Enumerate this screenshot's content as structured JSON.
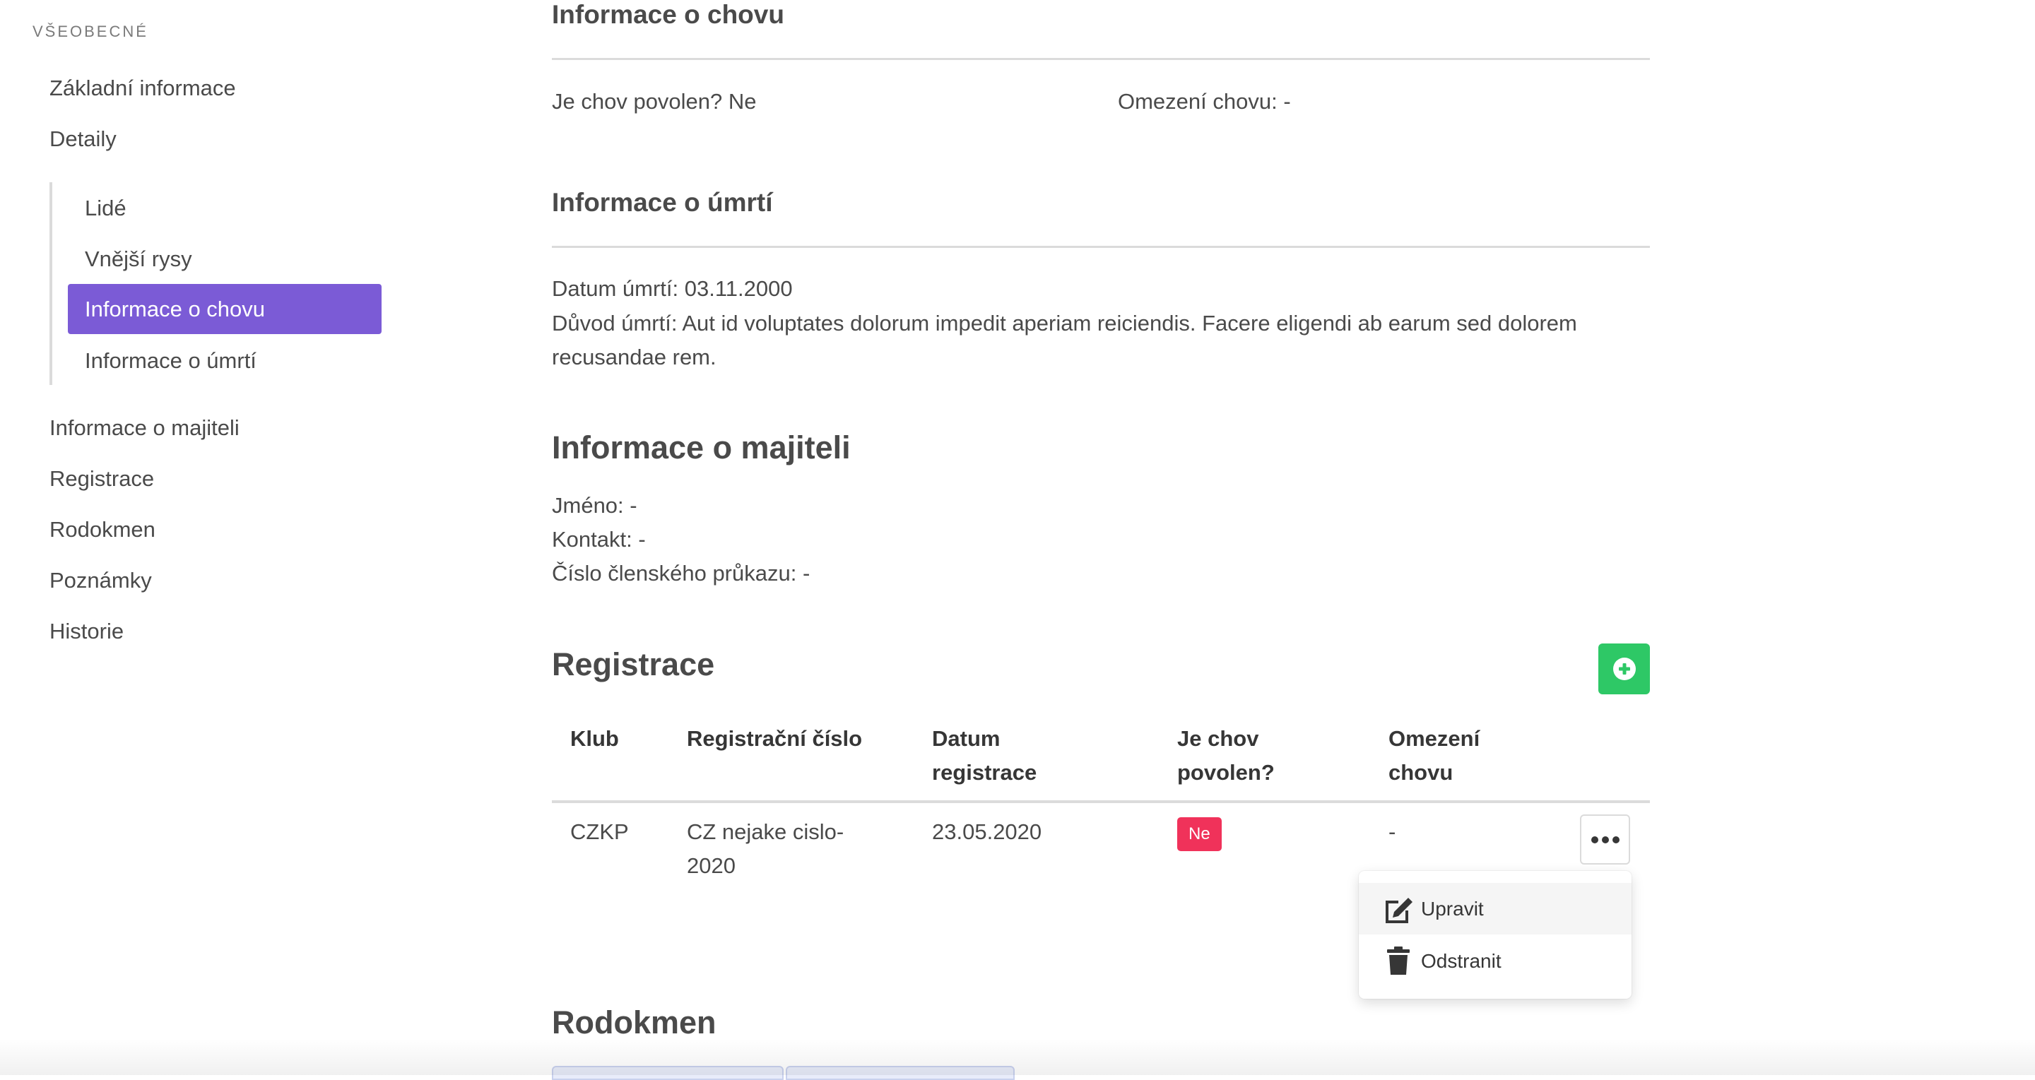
{
  "sidebar": {
    "menu_label": "VŠEOBECNÉ",
    "items": [
      {
        "label": "Základní informace"
      },
      {
        "label": "Detaily"
      },
      {
        "label": "Informace o majiteli"
      },
      {
        "label": "Registrace"
      },
      {
        "label": "Rodokmen"
      },
      {
        "label": "Poznámky"
      },
      {
        "label": "Historie"
      }
    ],
    "sub_items": [
      {
        "label": "Lidé"
      },
      {
        "label": "Vnější rysy"
      },
      {
        "label": "Informace o chovu",
        "active": true
      },
      {
        "label": "Informace o úmrtí"
      }
    ],
    "accent_color": "#7b5bd6"
  },
  "breeding": {
    "title": "Informace o chovu",
    "allowed_text": "Je chov povolen? Ne",
    "restriction_text": "Omezení chovu: -"
  },
  "death": {
    "title": "Informace o úmrtí",
    "date_text": "Datum úmrtí: 03.11.2000",
    "reason_text": "Důvod úmrtí: Aut id voluptates dolorum impedit aperiam reiciendis. Facere eligendi ab earum sed dolorem recusandae rem."
  },
  "owner": {
    "title": "Informace o majiteli",
    "name_text": "Jméno: -",
    "contact_text": "Kontakt: -",
    "card_text": "Číslo členského průkazu: -"
  },
  "registration": {
    "title": "Registrace",
    "add_button_icon": "plus-circle-icon",
    "add_button_color": "#2ec866",
    "columns": {
      "club": "Klub",
      "reg_number": "Registrační číslo",
      "reg_date": [
        "Datum",
        "registrace"
      ],
      "breeding_allowed": [
        "Je chov",
        "povolen?"
      ],
      "restriction": [
        "Omezení",
        "chovu"
      ]
    },
    "rows": [
      {
        "club": "CZKP",
        "reg_number": [
          "CZ nejake cislo-",
          "2020"
        ],
        "reg_date": "23.05.2020",
        "breeding_allowed": "Ne",
        "restriction": "-"
      }
    ],
    "badge_color": "#f0325a",
    "row_menu": {
      "icon": "more-dots-icon",
      "items": [
        {
          "label": "Upravit",
          "icon": "edit-icon"
        },
        {
          "label": "Odstranit",
          "icon": "trash-icon"
        }
      ]
    }
  },
  "pedigree": {
    "title": "Rodokmen"
  }
}
